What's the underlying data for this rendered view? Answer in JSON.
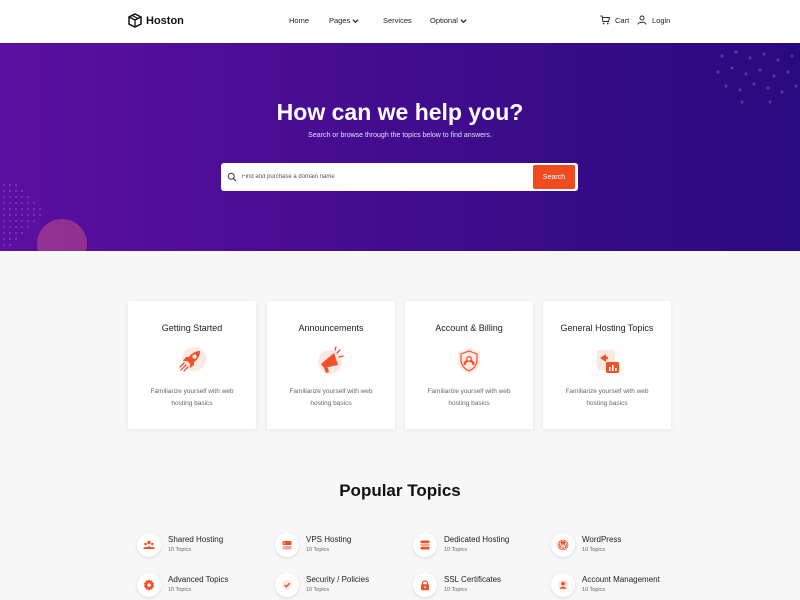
{
  "nav": {
    "logo_text": "Hoston",
    "menu": [
      {
        "label": "Home"
      },
      {
        "label": "Pages"
      },
      {
        "label": "Services"
      },
      {
        "label": "Optional"
      }
    ],
    "cart_label": "Cart",
    "login_label": "Login",
    "icons": [
      "box-logo-icon",
      "chevron-down-icon",
      "cart-icon",
      "user-icon"
    ]
  },
  "hero": {
    "title": "How can we help you?",
    "subtitle": "Search or browse through the topics below to find answers.",
    "search_placeholder": "Find and purchase a domain name",
    "search_value": "",
    "search_button": "Search",
    "gradient": [
      "#5c0fa0",
      "#2a0a80"
    ]
  },
  "cards": [
    {
      "title": "Getting Started",
      "description": "Familiarize yourself with web hosting basics",
      "icon": "rocket-icon"
    },
    {
      "title": "Announcements",
      "description": "Familiarize yourself with web hosting basics",
      "icon": "megaphone-icon"
    },
    {
      "title": "Account & Billing",
      "description": "Familiarize yourself with web hosting basics",
      "icon": "shield-user-icon"
    },
    {
      "title": "General Hosting Topics",
      "description": "Familiarize yourself with web hosting basics",
      "icon": "analytics-icon"
    }
  ],
  "popular": {
    "title": "Popular Topics",
    "topics": [
      {
        "name": "Shared Hosting",
        "count": "10 Topics",
        "icon": "users-icon"
      },
      {
        "name": "VPS Hosting",
        "count": "10 Topics",
        "icon": "server-icon"
      },
      {
        "name": "Dedicated Hosting",
        "count": "10 Topics",
        "icon": "server-stack-icon"
      },
      {
        "name": "WordPress",
        "count": "10 Topics",
        "icon": "wordpress-icon"
      },
      {
        "name": "Advanced Topics",
        "count": "10 Topics",
        "icon": "gear-icon"
      },
      {
        "name": "Security / Policies",
        "count": "10 Topics",
        "icon": "shield-check-icon"
      },
      {
        "name": "SSL Certificates",
        "count": "10 Topics",
        "icon": "lock-icon"
      },
      {
        "name": "Account Management",
        "count": "10 Topics",
        "icon": "account-icon"
      }
    ]
  },
  "colors": {
    "accent": "#f04a1e",
    "icon_accent": "#f0512b",
    "hero_start": "#5c0fa0",
    "hero_end": "#2a0a80"
  }
}
